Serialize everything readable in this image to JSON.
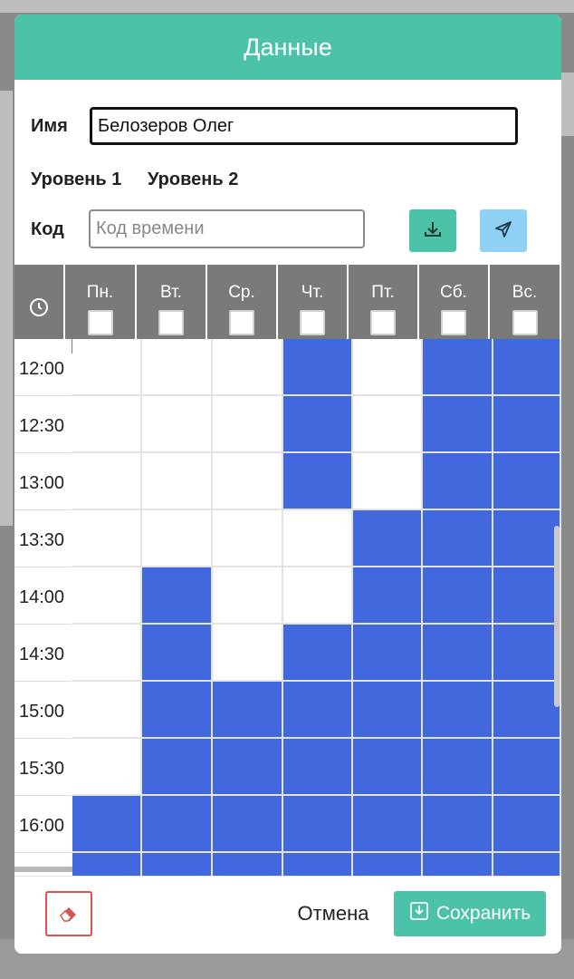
{
  "modal": {
    "title": "Данные",
    "name_label": "Имя",
    "name_value": "Белозеров Олег",
    "level1_label": "Уровень 1",
    "level2_label": "Уровень 2",
    "code_label": "Код",
    "code_placeholder": "Код времени",
    "download_icon": "download-icon",
    "send_icon": "send-icon"
  },
  "schedule": {
    "clock_icon": "clock-icon",
    "days": [
      "Пн.",
      "Вт.",
      "Ср.",
      "Чт.",
      "Пт.",
      "Сб.",
      "Вс."
    ],
    "times": [
      "12:00",
      "12:30",
      "13:00",
      "13:30",
      "14:00",
      "14:30",
      "15:00",
      "15:30",
      "16:00"
    ],
    "grid": [
      [
        0,
        0,
        0,
        1,
        0,
        1,
        1
      ],
      [
        0,
        0,
        0,
        1,
        0,
        1,
        1
      ],
      [
        0,
        0,
        0,
        1,
        0,
        1,
        1
      ],
      [
        0,
        0,
        0,
        0,
        1,
        1,
        1
      ],
      [
        0,
        1,
        0,
        0,
        1,
        1,
        1
      ],
      [
        0,
        1,
        0,
        1,
        1,
        1,
        1
      ],
      [
        0,
        1,
        1,
        1,
        1,
        1,
        1
      ],
      [
        0,
        1,
        1,
        1,
        1,
        1,
        1
      ],
      [
        1,
        1,
        1,
        1,
        1,
        1,
        1
      ],
      [
        1,
        1,
        1,
        1,
        1,
        1,
        1
      ]
    ],
    "on_color": "#4268de"
  },
  "footer": {
    "eraser_icon": "eraser-icon",
    "cancel_label": "Отмена",
    "save_label": "Сохранить",
    "save_icon": "save-icon"
  },
  "colors": {
    "accent": "#4cc3a9",
    "send_button": "#8fd0f5",
    "danger": "#d9534f",
    "header_gray": "#7a7a7a"
  }
}
